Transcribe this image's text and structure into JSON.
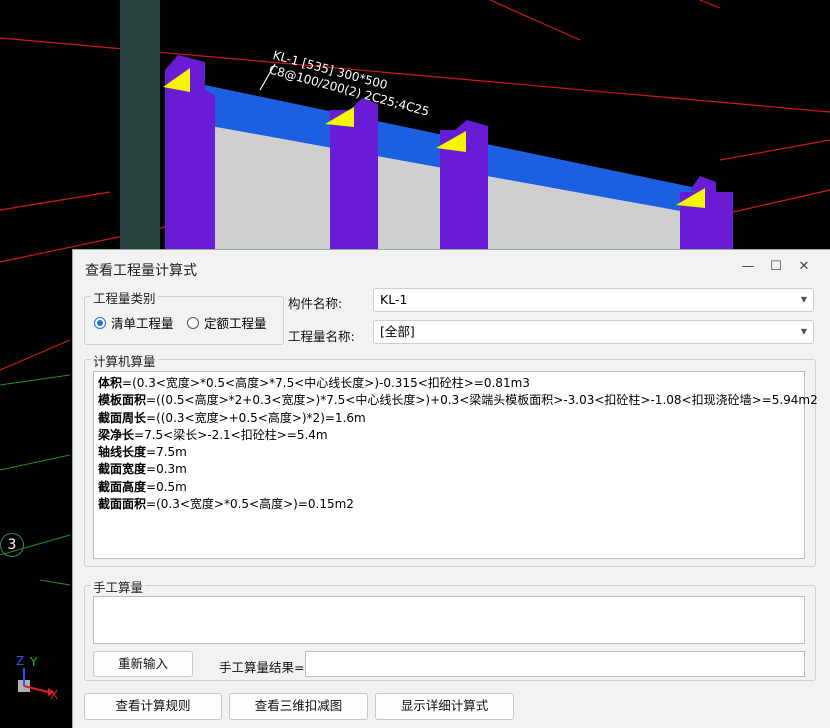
{
  "scene": {
    "beam_label_line1": "KL-1 [535] 300*500",
    "beam_label_line2": "C8@100/200(2) 2C25;4C25",
    "axis_marker": "3",
    "axis_x": "X",
    "axis_y": "Y",
    "axis_z": "Z"
  },
  "dialog": {
    "title": "查看工程量计算式",
    "controls": {
      "minimize": "—",
      "maximize": "☐",
      "close": "✕"
    },
    "category": {
      "title": "工程量类别",
      "options": [
        "清单工程量",
        "定额工程量"
      ],
      "selected": "清单工程量"
    },
    "component_name_label": "构件名称:",
    "component_name_value": "KL-1",
    "quantity_name_label": "工程量名称:",
    "quantity_name_value": "[全部]",
    "computer_section": {
      "title": "计算机算量",
      "lines": [
        {
          "key": "体积",
          "expr": "=(0.3<宽度>*0.5<高度>*7.5<中心线长度>)-0.315<扣砼柱>=0.81m3"
        },
        {
          "key": "模板面积",
          "expr": "=((0.5<高度>*2+0.3<宽度>)*7.5<中心线长度>)+0.3<梁端头模板面积>-3.03<扣砼柱>-1.08<扣现浇砼墙>=5.94m2"
        },
        {
          "key": "截面周长",
          "expr": "=((0.3<宽度>+0.5<高度>)*2)=1.6m"
        },
        {
          "key": "梁净长",
          "expr": "=7.5<梁长>-2.1<扣砼柱>=5.4m"
        },
        {
          "key": "轴线长度",
          "expr": "=7.5m"
        },
        {
          "key": "截面宽度",
          "expr": "=0.3m"
        },
        {
          "key": "截面高度",
          "expr": "=0.5m"
        },
        {
          "key": "截面面积",
          "expr": "=(0.3<宽度>*0.5<高度>)=0.15m2"
        }
      ]
    },
    "manual_section": {
      "title": "手工算量",
      "reinput_button": "重新输入",
      "result_label": "手工算量结果=",
      "result_value": ""
    },
    "footer_buttons": [
      "查看计算规则",
      "查看三维扣减图",
      "显示详细计算式"
    ]
  },
  "colors": {
    "column": "#6a1bd6",
    "beam_top": "#1c5fe0",
    "wall": "#c8c8c8",
    "grid_line": "#d01818",
    "selected_radio": "#1a73e8"
  }
}
